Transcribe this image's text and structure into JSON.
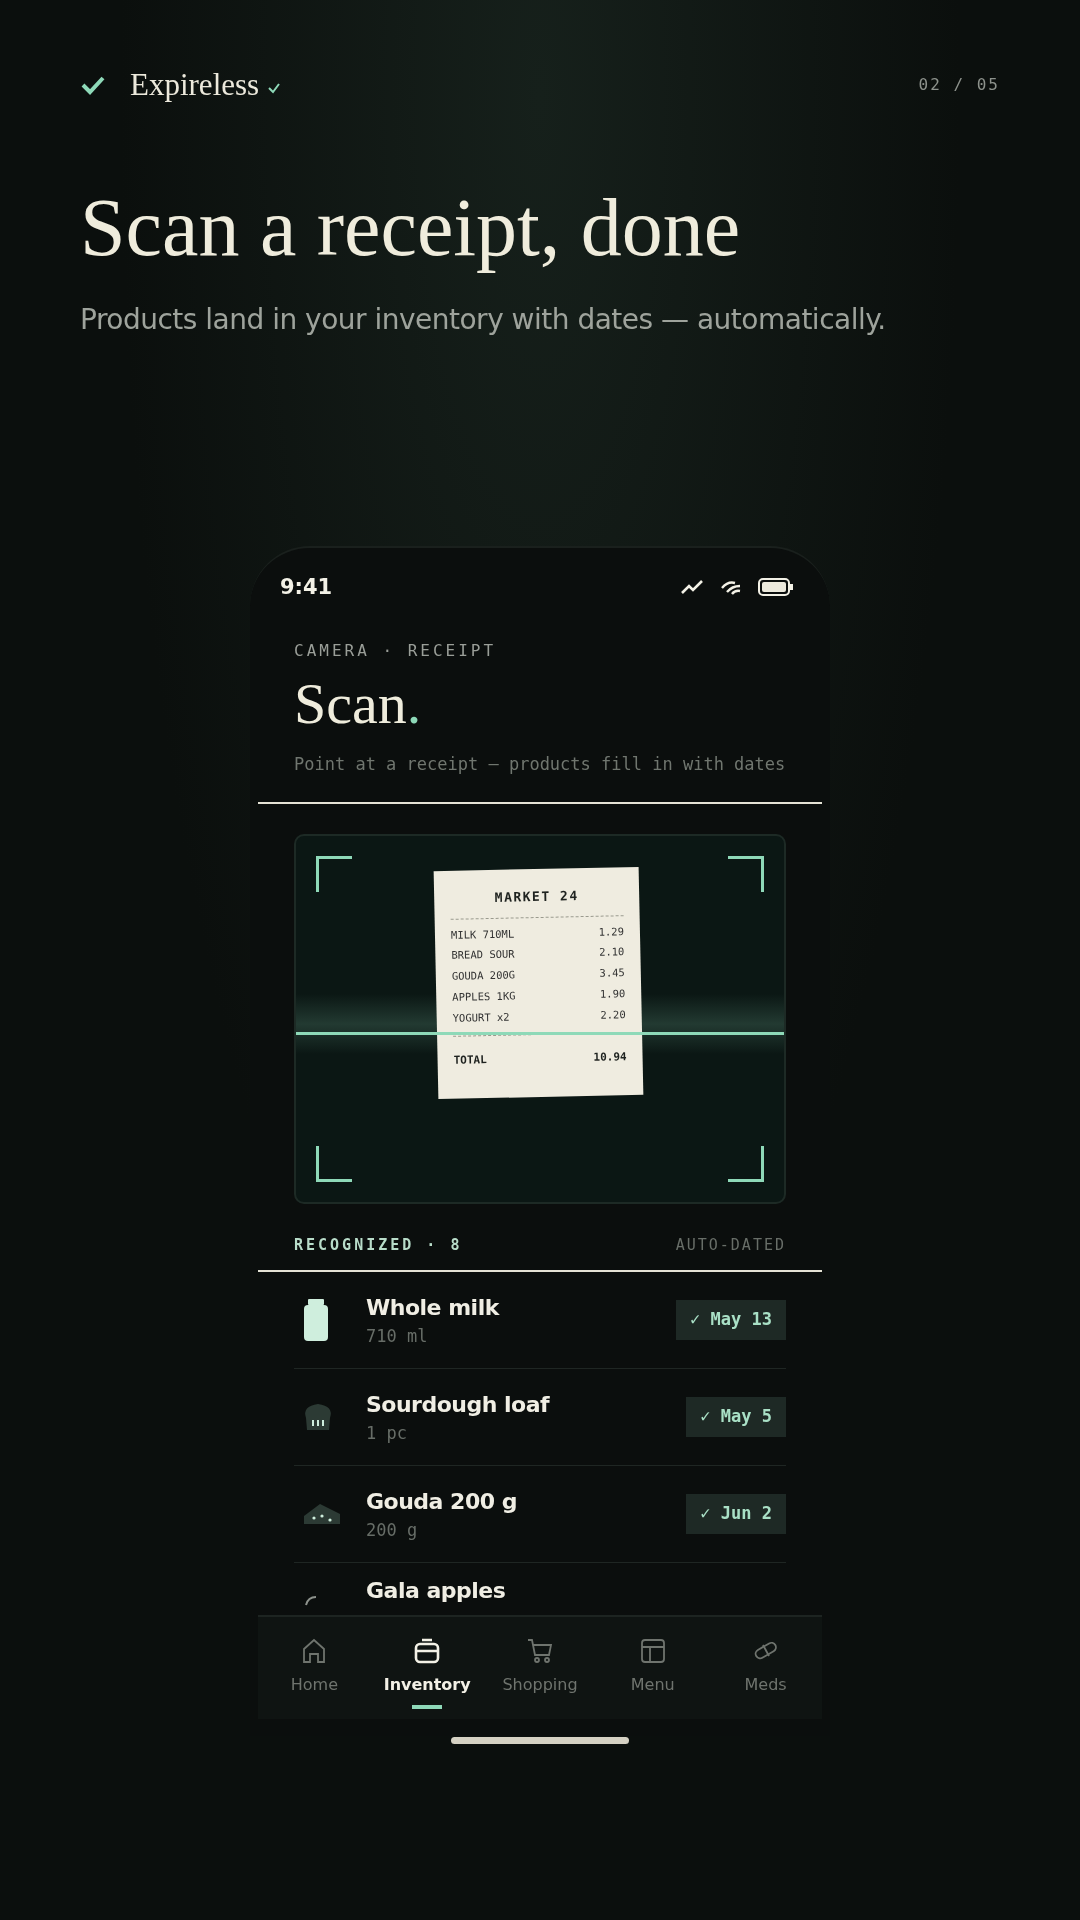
{
  "brand": {
    "name": "Expireless",
    "step": "02 / 05"
  },
  "headline": "Scan a receipt, done",
  "subhead": "Products land in your inventory with dates — automatically.",
  "phone": {
    "status_bar": {
      "time": "9:41"
    },
    "eyebrow": "CAMERA · RECEIPT",
    "title": "Scan",
    "title_dot": ".",
    "hint": "Point at a receipt — products fill in with dates",
    "receipt": {
      "store": "MARKET 24",
      "lines": [
        {
          "item": "MILK 710ML",
          "price": "1.29"
        },
        {
          "item": "BREAD SOUR",
          "price": "2.10"
        },
        {
          "item": "GOUDA 200G",
          "price": "3.45"
        },
        {
          "item": "APPLES 1KG",
          "price": "1.90"
        },
        {
          "item": "YOGURT x2",
          "price": "2.20"
        }
      ],
      "total_label": "TOTAL",
      "total": "10.94"
    },
    "recognized": {
      "label": "RECOGNIZED · 8",
      "note": "AUTO-DATED"
    },
    "items": [
      {
        "kind": "milk",
        "name": "Whole milk",
        "amount": "710 ml",
        "date": "May 13",
        "check": "✓"
      },
      {
        "kind": "bread",
        "name": "Sourdough loaf",
        "amount": "1 pc",
        "date": "May 5",
        "check": "✓"
      },
      {
        "kind": "cheese",
        "name": "Gouda 200 g",
        "amount": "200 g",
        "date": "Jun 2",
        "check": "✓"
      },
      {
        "kind": "apple",
        "name": "Gala apples"
      }
    ],
    "tabs": [
      {
        "kind": "home",
        "label": "Home",
        "selected": false
      },
      {
        "kind": "inventory",
        "label": "Inventory",
        "selected": true
      },
      {
        "kind": "cart",
        "label": "Shopping",
        "selected": false
      },
      {
        "kind": "menu",
        "label": "Menu",
        "selected": false
      },
      {
        "kind": "pill",
        "label": "Meds",
        "selected": false
      }
    ]
  }
}
